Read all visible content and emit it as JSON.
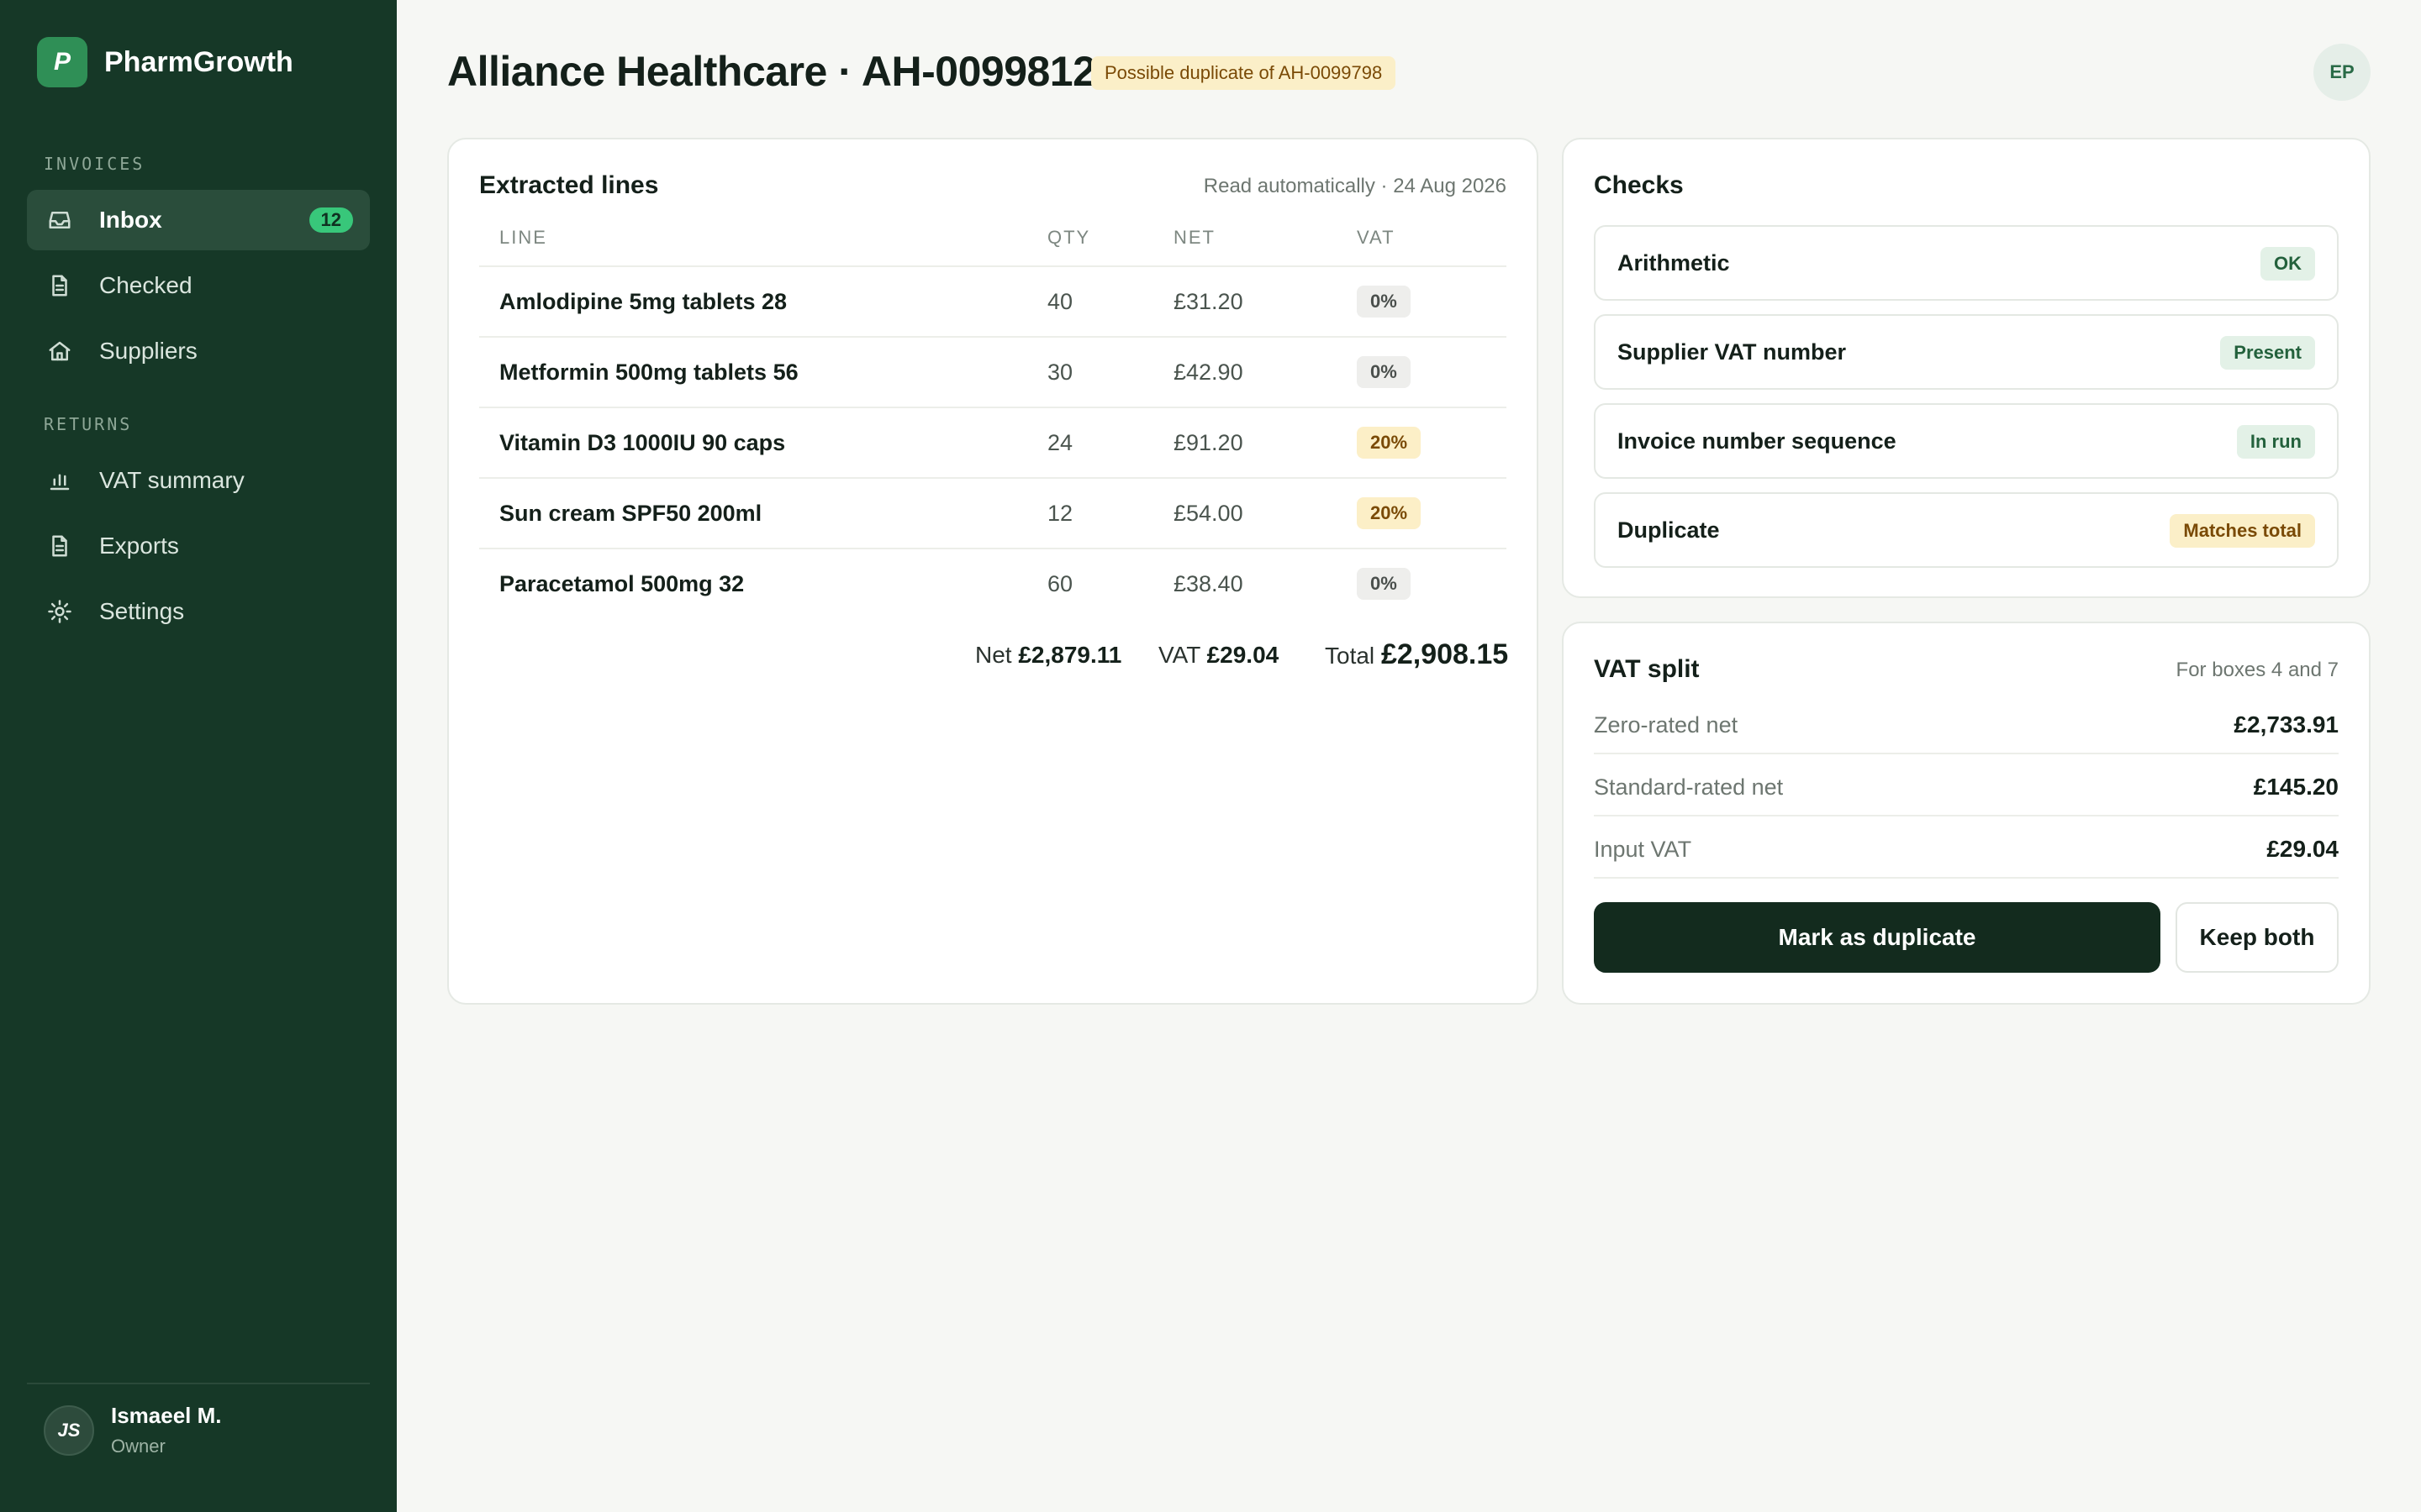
{
  "app": {
    "name": "PharmGrowth",
    "logo_letter": "P"
  },
  "sidebar": {
    "sections": [
      {
        "label": "INVOICES"
      },
      {
        "label": "RETURNS"
      }
    ],
    "items": [
      {
        "label": "Inbox",
        "icon": "inbox-icon",
        "badge": "12",
        "active": true
      },
      {
        "label": "Checked",
        "icon": "document-icon"
      },
      {
        "label": "Suppliers",
        "icon": "home-icon"
      },
      {
        "label": "VAT summary",
        "icon": "bar-chart-icon"
      },
      {
        "label": "Exports",
        "icon": "document-icon"
      },
      {
        "label": "Settings",
        "icon": "gear-icon"
      }
    ],
    "user": {
      "initials": "JS",
      "name": "Ismaeel M.",
      "role": "Owner"
    }
  },
  "header": {
    "title": "Alliance Healthcare · AH-0099812",
    "duplicate_badge": "Possible duplicate of AH-0099798",
    "avatar_initials": "EP"
  },
  "lines_card": {
    "title": "Extracted lines",
    "meta": "Read automatically · 24 Aug 2026",
    "columns": [
      "LINE",
      "QTY",
      "NET",
      "VAT"
    ],
    "rows": [
      {
        "line": "Amlodipine 5mg tablets 28",
        "qty": "40",
        "net": "£31.20",
        "vat": "0%"
      },
      {
        "line": "Metformin 500mg tablets 56",
        "qty": "30",
        "net": "£42.90",
        "vat": "0%"
      },
      {
        "line": "Vitamin D3 1000IU 90 caps",
        "qty": "24",
        "net": "£91.20",
        "vat": "20%"
      },
      {
        "line": "Sun cream SPF50 200ml",
        "qty": "12",
        "net": "£54.00",
        "vat": "20%"
      },
      {
        "line": "Paracetamol 500mg 32",
        "qty": "60",
        "net": "£38.40",
        "vat": "0%"
      }
    ],
    "totals": {
      "net_label": "Net",
      "net_value": "£2,879.11",
      "vat_label": "VAT",
      "vat_value": "£29.04",
      "total_label": "Total",
      "total_value": "£2,908.15"
    }
  },
  "checks_card": {
    "title": "Checks",
    "items": [
      {
        "label": "Arithmetic",
        "status": "OK",
        "tone": "ok"
      },
      {
        "label": "Supplier VAT number",
        "status": "Present",
        "tone": "ok"
      },
      {
        "label": "Invoice number sequence",
        "status": "In run",
        "tone": "ok"
      },
      {
        "label": "Duplicate",
        "status": "Matches total",
        "tone": "warn"
      }
    ]
  },
  "vat_split_card": {
    "title": "VAT split",
    "meta": "For boxes 4 and 7",
    "rows": [
      {
        "label": "Zero-rated net",
        "value": "£2,733.91"
      },
      {
        "label": "Standard-rated net",
        "value": "£145.20"
      },
      {
        "label": "Input VAT",
        "value": "£29.04"
      }
    ],
    "primary_action": "Mark as duplicate",
    "secondary_action": "Keep both"
  },
  "colors": {
    "sidebar_bg": "#163827",
    "accent_green": "#38c77a",
    "warning_bg": "#fbefc8",
    "primary_button": "#132b1e"
  }
}
